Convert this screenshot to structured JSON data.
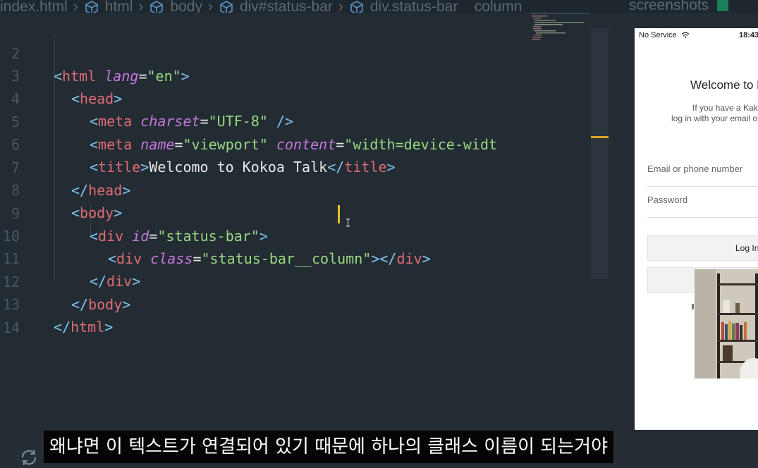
{
  "breadcrumb": {
    "items": [
      "index.html",
      "html",
      "body",
      "div#status-bar",
      "div.status-bar__column"
    ]
  },
  "panel": {
    "title": "screenshots"
  },
  "editor": {
    "lines": [
      {
        "n": "2"
      },
      {
        "n": "3"
      },
      {
        "n": "4"
      },
      {
        "n": "5"
      },
      {
        "n": "6"
      },
      {
        "n": "7"
      },
      {
        "n": "8"
      },
      {
        "n": "9"
      },
      {
        "n": "10"
      },
      {
        "n": "11"
      },
      {
        "n": "12"
      },
      {
        "n": "13"
      },
      {
        "n": "14"
      }
    ],
    "tokens": {
      "html": "html",
      "lang": "lang",
      "en": "\"en\"",
      "head": "head",
      "meta": "meta",
      "charset": "charset",
      "utf8": "\"UTF-8\"",
      "name": "name",
      "viewport": "\"viewport\"",
      "content": "content",
      "cval": "\"width=device-widt",
      "title": "title",
      "title_text": "Welcomo to Kokoa Talk",
      "body": "body",
      "div": "div",
      "id": "id",
      "status_bar": "\"status-bar\"",
      "class": "class",
      "column_class": "\"status-bar__column\""
    }
  },
  "phone": {
    "carrier": "No Service",
    "time": "18:43",
    "welcome": "Welcome to K",
    "sub1": "If you have a Kak",
    "sub2": "log in with your email o",
    "email_placeholder": "Email or phone number",
    "password_placeholder": "Password",
    "login_label": "Log In"
  },
  "subtitle": "왜냐면 이 텍스트가 연결되어 있기 때문에 하나의 클래스 이름이 되는거야",
  "colors": {
    "tag": "#e06c75",
    "string": "#98d982",
    "attr": "#c678dd",
    "bracket": "#7fc7ee",
    "bg": "#232b33"
  }
}
